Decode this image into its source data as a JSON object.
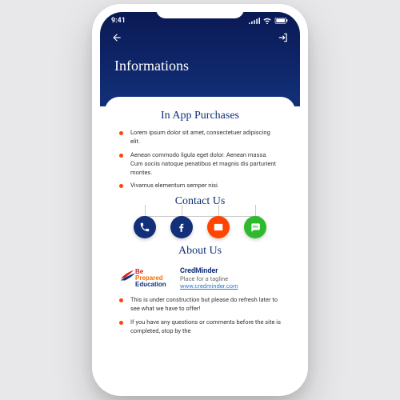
{
  "status": {
    "time": "9:41",
    "signal": "••••",
    "wifi": "✶",
    "battery": "▮"
  },
  "title": "Informations",
  "iap": {
    "heading": "In App Purchases",
    "items": [
      "Lorem ipsum dolor sit amet, consectetuer adipiscing elit.",
      "Aenean commodo ligula eget dolor. Aenean massa. Cum sociis natoque penatibus et magnis dis parturient montes.",
      "Vivamus elementum semper nisi."
    ]
  },
  "contact": {
    "heading": "Contact Us",
    "buttons": [
      {
        "name": "phone-icon",
        "bg": "#12307a"
      },
      {
        "name": "facebook-icon",
        "bg": "#12307a"
      },
      {
        "name": "email-icon",
        "bg": "#ff4500"
      },
      {
        "name": "sms-icon",
        "bg": "#2dbb2d"
      }
    ]
  },
  "about": {
    "heading": "About Us",
    "logo": {
      "l1": "Be",
      "l2": "Prepared",
      "l3": "Education"
    },
    "brand": "CredMinder",
    "tagline": "Place for a tagline",
    "url_text": "www.credminder.com",
    "bullets": [
      "This is under construction but please do refresh later to see what we have to offer!",
      "If you have any questions or comments before the site is completed, stop by the"
    ]
  }
}
